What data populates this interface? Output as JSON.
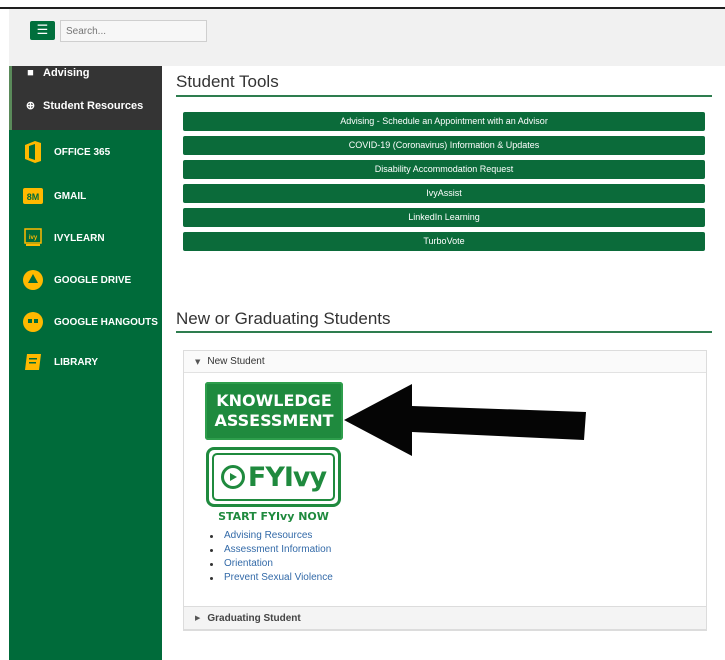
{
  "header": {
    "search_placeholder": "Search..."
  },
  "sidebar": {
    "sub_items": [
      {
        "label": "Advising",
        "icon": "graduation-icon"
      },
      {
        "label": "Student Resources",
        "icon": "plus-circle-icon"
      }
    ],
    "items": [
      {
        "label": "OFFICE 365",
        "icon": "office365-icon"
      },
      {
        "label": "GMAIL",
        "icon": "gmail-icon"
      },
      {
        "label": "IVYLEARN",
        "icon": "ivylearn-icon"
      },
      {
        "label": "GOOGLE DRIVE",
        "icon": "google-drive-icon"
      },
      {
        "label": "GOOGLE HANGOUTS",
        "icon": "hangouts-icon"
      },
      {
        "label": "LIBRARY",
        "icon": "book-icon"
      }
    ]
  },
  "student_tools": {
    "title": "Student Tools",
    "buttons": [
      "Advising - Schedule an Appointment with an Advisor",
      "COVID-19 (Coronavirus) Information & Updates",
      "Disability Accommodation Request",
      "IvyAssist",
      "LinkedIn Learning",
      "TurboVote"
    ]
  },
  "new_grad": {
    "title": "New or Graduating Students",
    "new_student": {
      "header": "New Student",
      "knowledge_line1": "KNOWLEDGE",
      "knowledge_line2": "ASSESSMENT",
      "fyivy_text": "FYIvy",
      "fyivy_cta": "START FYIvy NOW",
      "links": [
        "Advising Resources",
        "Assessment Information",
        "Orientation",
        "Prevent Sexual Violence"
      ]
    },
    "graduating_student": {
      "header": "Graduating Student"
    }
  },
  "colors": {
    "brand_green": "#006b3a",
    "dark": "#343434",
    "link": "#336aa8"
  }
}
